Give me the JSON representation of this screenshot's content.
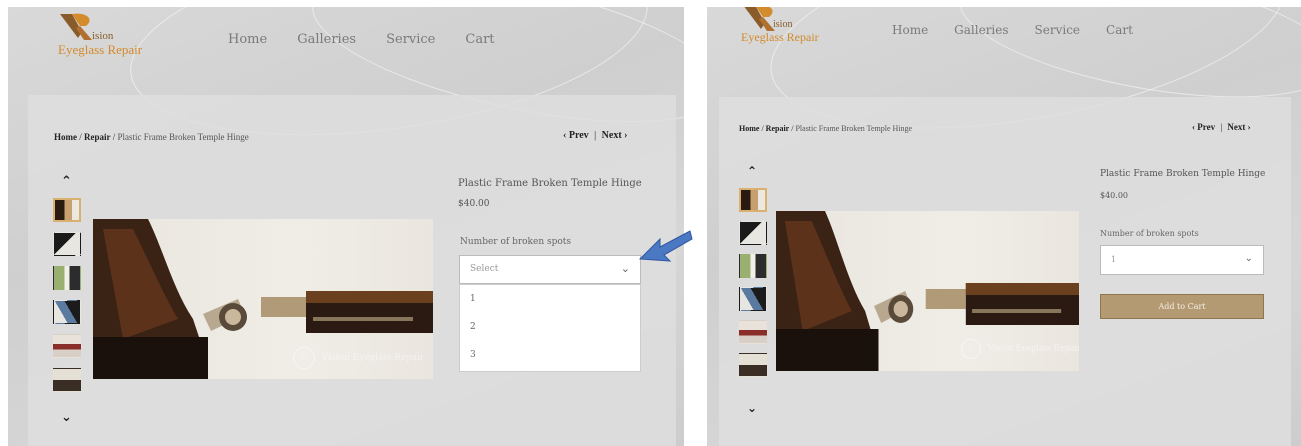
{
  "colors": {
    "logo_dark": "#8a5b2a",
    "logo_orange": "#d38b2c",
    "button": "#b49a73",
    "arrow_blue": "#4a78c2"
  },
  "logo": {
    "word_top": "ision",
    "word_bottom": "Eyeglass Repair"
  },
  "nav": [
    "Home",
    "Galleries",
    "Service",
    "Cart"
  ],
  "breadcrumb": {
    "home": "Home",
    "sep": " / ",
    "repair": "Repair",
    "current": "Plastic Frame Broken Temple Hinge"
  },
  "pager": {
    "prev": "Prev",
    "divider": "|",
    "next": "Next"
  },
  "product": {
    "title": "Plastic Frame Broken Temple Hinge",
    "price": "$40.00",
    "option_label": "Number of broken spots",
    "placeholder": "Select",
    "options": [
      "1",
      "2",
      "3"
    ],
    "selected": "1",
    "add_to_cart": "Add to Cart"
  },
  "watermark": {
    "symbol": "©",
    "text": "Vision Eyeglass Repair"
  },
  "icons": {
    "up": "chevron-up-icon",
    "down": "chevron-down-icon",
    "prev": "chevron-left-icon",
    "next": "chevron-right-icon",
    "callout": "blue-arrow-icon"
  }
}
